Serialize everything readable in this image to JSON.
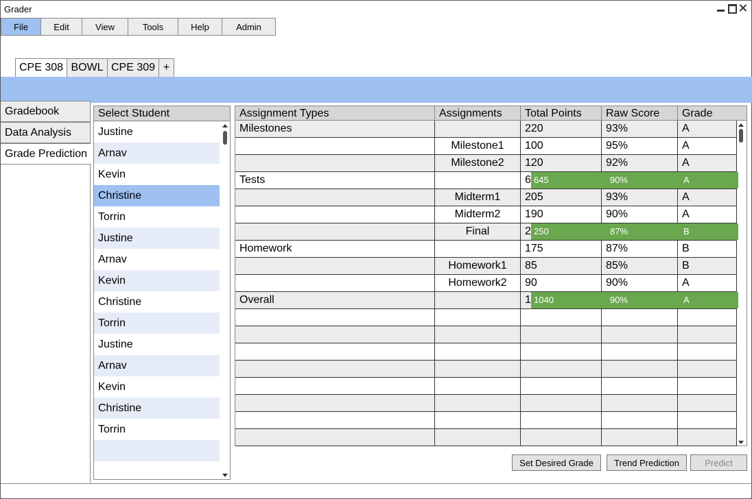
{
  "window": {
    "title": "Grader"
  },
  "menu": [
    {
      "label": "File",
      "active": true
    },
    {
      "label": "Edit"
    },
    {
      "label": "View"
    },
    {
      "label": "Tools"
    },
    {
      "label": "Help"
    },
    {
      "label": "Admin"
    }
  ],
  "course_tabs": [
    "CPE 308",
    "BOWL",
    "CPE 309",
    "+"
  ],
  "side_nav": [
    {
      "label": "Gradebook"
    },
    {
      "label": "Data Analysis"
    },
    {
      "label": "Grade Prediction",
      "selected": true
    }
  ],
  "student_list": {
    "header": "Select Student",
    "students": [
      "Justine",
      "Arnav",
      "Kevin",
      "Christine",
      "Torrin",
      "Justine",
      "Arnav",
      "Kevin",
      "Christine",
      "Torrin",
      "Justine",
      "Arnav",
      "Kevin",
      "Christine",
      "Torrin",
      ""
    ],
    "selected_index": 3
  },
  "grade_table": {
    "headers": [
      "Assignment Types",
      "Assignments",
      "Total Points",
      "Raw Score",
      "Grade"
    ],
    "rows": [
      {
        "type": "Milestones",
        "assignment": "",
        "total": "220",
        "raw": "93%",
        "grade": "A"
      },
      {
        "type": "",
        "assignment": "Milestone1",
        "total": "100",
        "raw": "95%",
        "grade": "A"
      },
      {
        "type": "",
        "assignment": "Milestone2",
        "total": "120",
        "raw": "92%",
        "grade": "A"
      },
      {
        "type": "Tests",
        "assignment": "",
        "total": "6",
        "raw": "",
        "grade": "",
        "prediction": {
          "total": "645",
          "raw": "90%",
          "grade": "A"
        }
      },
      {
        "type": "",
        "assignment": "Midterm1",
        "total": "205",
        "raw": "93%",
        "grade": "A"
      },
      {
        "type": "",
        "assignment": "Midterm2",
        "total": "190",
        "raw": "90%",
        "grade": "A"
      },
      {
        "type": "",
        "assignment": "Final",
        "total": "2",
        "raw": "",
        "grade": "",
        "prediction": {
          "total": "250",
          "raw": "87%",
          "grade": "B"
        }
      },
      {
        "type": "Homework",
        "assignment": "",
        "total": "175",
        "raw": "87%",
        "grade": "B"
      },
      {
        "type": "",
        "assignment": "Homework1",
        "total": "85",
        "raw": "85%",
        "grade": "B"
      },
      {
        "type": "",
        "assignment": "Homework2",
        "total": "90",
        "raw": "90%",
        "grade": "A"
      },
      {
        "type": "Overall",
        "assignment": "",
        "total": "1",
        "raw": "",
        "grade": "",
        "prediction": {
          "total": "1040",
          "raw": "90%",
          "grade": "A"
        }
      },
      {
        "type": "",
        "assignment": "",
        "total": "",
        "raw": "",
        "grade": ""
      },
      {
        "type": "",
        "assignment": "",
        "total": "",
        "raw": "",
        "grade": ""
      },
      {
        "type": "",
        "assignment": "",
        "total": "",
        "raw": "",
        "grade": ""
      },
      {
        "type": "",
        "assignment": "",
        "total": "",
        "raw": "",
        "grade": ""
      },
      {
        "type": "",
        "assignment": "",
        "total": "",
        "raw": "",
        "grade": ""
      },
      {
        "type": "",
        "assignment": "",
        "total": "",
        "raw": "",
        "grade": ""
      },
      {
        "type": "",
        "assignment": "",
        "total": "",
        "raw": "",
        "grade": ""
      },
      {
        "type": "",
        "assignment": "",
        "total": "",
        "raw": "",
        "grade": ""
      }
    ]
  },
  "buttons": {
    "set_desired_grade": "Set Desired Grade",
    "trend_prediction": "Trend Prediction",
    "predict": "Predict"
  },
  "colors": {
    "accent_blue": "#9ec1f2",
    "prediction_green": "#6aa84f",
    "alt_row": "#e6ecf7"
  },
  "icons": [
    "minimize-icon",
    "maximize-icon",
    "close-icon",
    "scroll-up-arrow-icon",
    "scroll-down-arrow-icon"
  ]
}
